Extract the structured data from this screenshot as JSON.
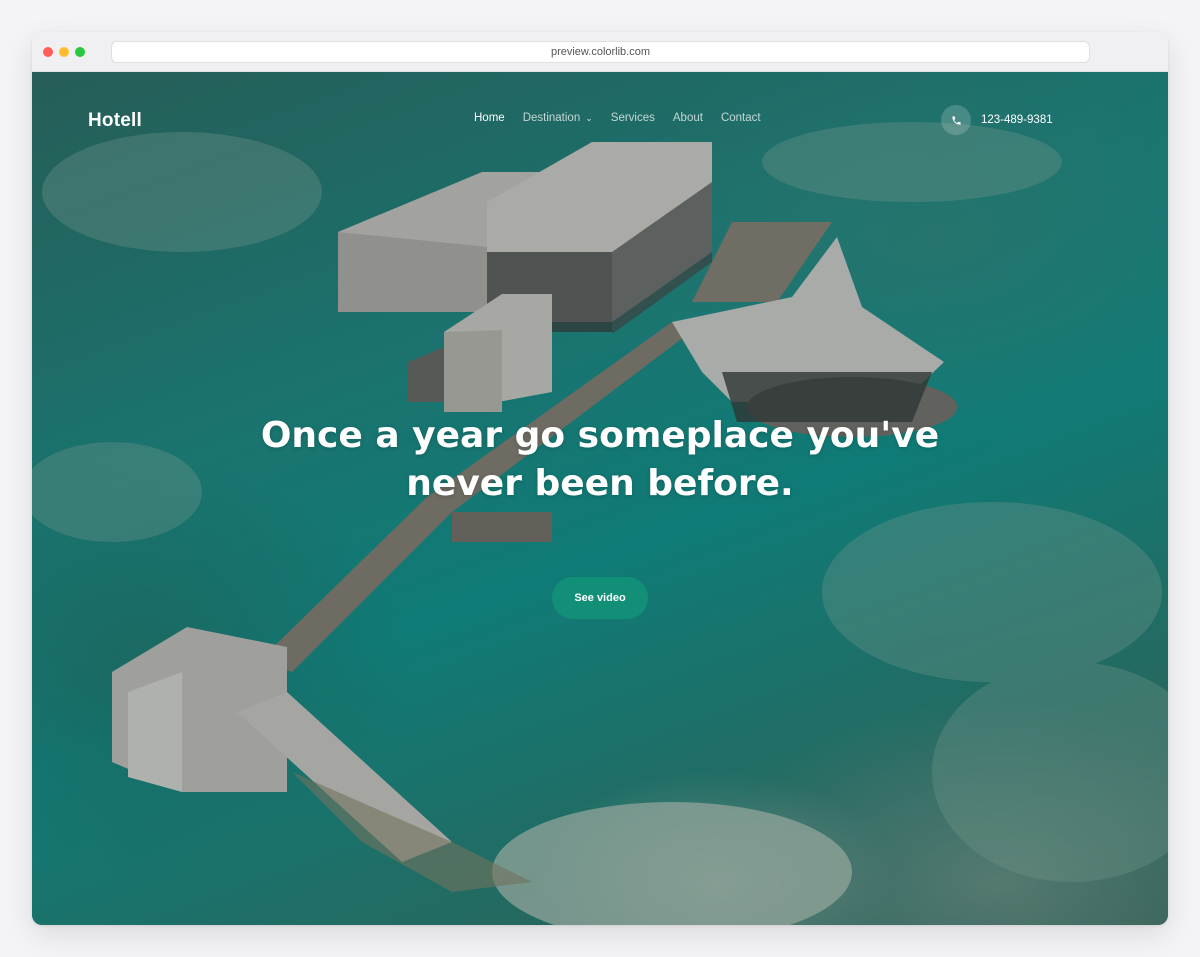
{
  "browser": {
    "url": "preview.colorlib.com",
    "window_controls": [
      "close-dot",
      "minimize-dot",
      "maximize-dot"
    ],
    "control_colors": [
      "#ff5f57",
      "#febc2e",
      "#28c840"
    ]
  },
  "nav": {
    "logo": "Hotell",
    "items": [
      {
        "label": "Home",
        "active": true
      },
      {
        "label": "Destination",
        "dropdown": true
      },
      {
        "label": "Services"
      },
      {
        "label": "About"
      },
      {
        "label": "Contact"
      }
    ],
    "dropdown_icon": "chevron-down-icon",
    "phone_icon": "phone-icon",
    "phone_number": "123-489-9381"
  },
  "hero": {
    "headline_line1": "Once a year go someplace you've",
    "headline_line2": "never been before.",
    "cta_label": "See video"
  },
  "colors": {
    "accent": "#129077",
    "text_on_image": "#ffffff"
  }
}
